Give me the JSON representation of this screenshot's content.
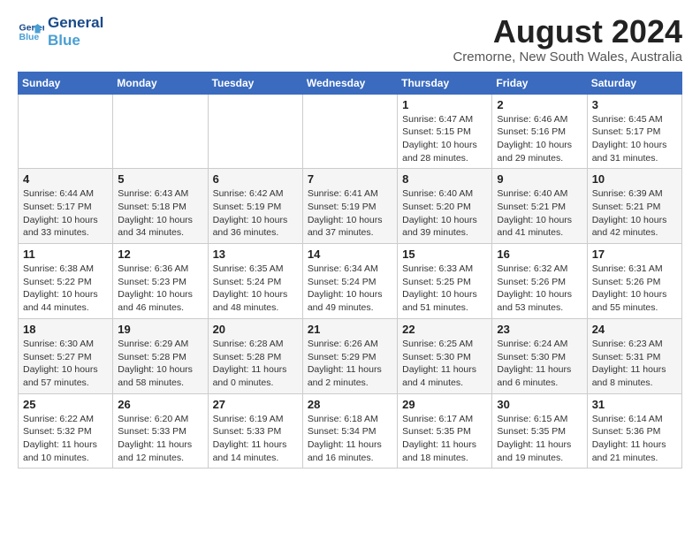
{
  "logo": {
    "line1": "General",
    "line2": "Blue"
  },
  "title": "August 2024",
  "location": "Cremorne, New South Wales, Australia",
  "days_of_week": [
    "Sunday",
    "Monday",
    "Tuesday",
    "Wednesday",
    "Thursday",
    "Friday",
    "Saturday"
  ],
  "weeks": [
    [
      {
        "day": "",
        "detail": ""
      },
      {
        "day": "",
        "detail": ""
      },
      {
        "day": "",
        "detail": ""
      },
      {
        "day": "",
        "detail": ""
      },
      {
        "day": "1",
        "detail": "Sunrise: 6:47 AM\nSunset: 5:15 PM\nDaylight: 10 hours\nand 28 minutes."
      },
      {
        "day": "2",
        "detail": "Sunrise: 6:46 AM\nSunset: 5:16 PM\nDaylight: 10 hours\nand 29 minutes."
      },
      {
        "day": "3",
        "detail": "Sunrise: 6:45 AM\nSunset: 5:17 PM\nDaylight: 10 hours\nand 31 minutes."
      }
    ],
    [
      {
        "day": "4",
        "detail": "Sunrise: 6:44 AM\nSunset: 5:17 PM\nDaylight: 10 hours\nand 33 minutes."
      },
      {
        "day": "5",
        "detail": "Sunrise: 6:43 AM\nSunset: 5:18 PM\nDaylight: 10 hours\nand 34 minutes."
      },
      {
        "day": "6",
        "detail": "Sunrise: 6:42 AM\nSunset: 5:19 PM\nDaylight: 10 hours\nand 36 minutes."
      },
      {
        "day": "7",
        "detail": "Sunrise: 6:41 AM\nSunset: 5:19 PM\nDaylight: 10 hours\nand 37 minutes."
      },
      {
        "day": "8",
        "detail": "Sunrise: 6:40 AM\nSunset: 5:20 PM\nDaylight: 10 hours\nand 39 minutes."
      },
      {
        "day": "9",
        "detail": "Sunrise: 6:40 AM\nSunset: 5:21 PM\nDaylight: 10 hours\nand 41 minutes."
      },
      {
        "day": "10",
        "detail": "Sunrise: 6:39 AM\nSunset: 5:21 PM\nDaylight: 10 hours\nand 42 minutes."
      }
    ],
    [
      {
        "day": "11",
        "detail": "Sunrise: 6:38 AM\nSunset: 5:22 PM\nDaylight: 10 hours\nand 44 minutes."
      },
      {
        "day": "12",
        "detail": "Sunrise: 6:36 AM\nSunset: 5:23 PM\nDaylight: 10 hours\nand 46 minutes."
      },
      {
        "day": "13",
        "detail": "Sunrise: 6:35 AM\nSunset: 5:24 PM\nDaylight: 10 hours\nand 48 minutes."
      },
      {
        "day": "14",
        "detail": "Sunrise: 6:34 AM\nSunset: 5:24 PM\nDaylight: 10 hours\nand 49 minutes."
      },
      {
        "day": "15",
        "detail": "Sunrise: 6:33 AM\nSunset: 5:25 PM\nDaylight: 10 hours\nand 51 minutes."
      },
      {
        "day": "16",
        "detail": "Sunrise: 6:32 AM\nSunset: 5:26 PM\nDaylight: 10 hours\nand 53 minutes."
      },
      {
        "day": "17",
        "detail": "Sunrise: 6:31 AM\nSunset: 5:26 PM\nDaylight: 10 hours\nand 55 minutes."
      }
    ],
    [
      {
        "day": "18",
        "detail": "Sunrise: 6:30 AM\nSunset: 5:27 PM\nDaylight: 10 hours\nand 57 minutes."
      },
      {
        "day": "19",
        "detail": "Sunrise: 6:29 AM\nSunset: 5:28 PM\nDaylight: 10 hours\nand 58 minutes."
      },
      {
        "day": "20",
        "detail": "Sunrise: 6:28 AM\nSunset: 5:28 PM\nDaylight: 11 hours\nand 0 minutes."
      },
      {
        "day": "21",
        "detail": "Sunrise: 6:26 AM\nSunset: 5:29 PM\nDaylight: 11 hours\nand 2 minutes."
      },
      {
        "day": "22",
        "detail": "Sunrise: 6:25 AM\nSunset: 5:30 PM\nDaylight: 11 hours\nand 4 minutes."
      },
      {
        "day": "23",
        "detail": "Sunrise: 6:24 AM\nSunset: 5:30 PM\nDaylight: 11 hours\nand 6 minutes."
      },
      {
        "day": "24",
        "detail": "Sunrise: 6:23 AM\nSunset: 5:31 PM\nDaylight: 11 hours\nand 8 minutes."
      }
    ],
    [
      {
        "day": "25",
        "detail": "Sunrise: 6:22 AM\nSunset: 5:32 PM\nDaylight: 11 hours\nand 10 minutes."
      },
      {
        "day": "26",
        "detail": "Sunrise: 6:20 AM\nSunset: 5:33 PM\nDaylight: 11 hours\nand 12 minutes."
      },
      {
        "day": "27",
        "detail": "Sunrise: 6:19 AM\nSunset: 5:33 PM\nDaylight: 11 hours\nand 14 minutes."
      },
      {
        "day": "28",
        "detail": "Sunrise: 6:18 AM\nSunset: 5:34 PM\nDaylight: 11 hours\nand 16 minutes."
      },
      {
        "day": "29",
        "detail": "Sunrise: 6:17 AM\nSunset: 5:35 PM\nDaylight: 11 hours\nand 18 minutes."
      },
      {
        "day": "30",
        "detail": "Sunrise: 6:15 AM\nSunset: 5:35 PM\nDaylight: 11 hours\nand 19 minutes."
      },
      {
        "day": "31",
        "detail": "Sunrise: 6:14 AM\nSunset: 5:36 PM\nDaylight: 11 hours\nand 21 minutes."
      }
    ]
  ]
}
